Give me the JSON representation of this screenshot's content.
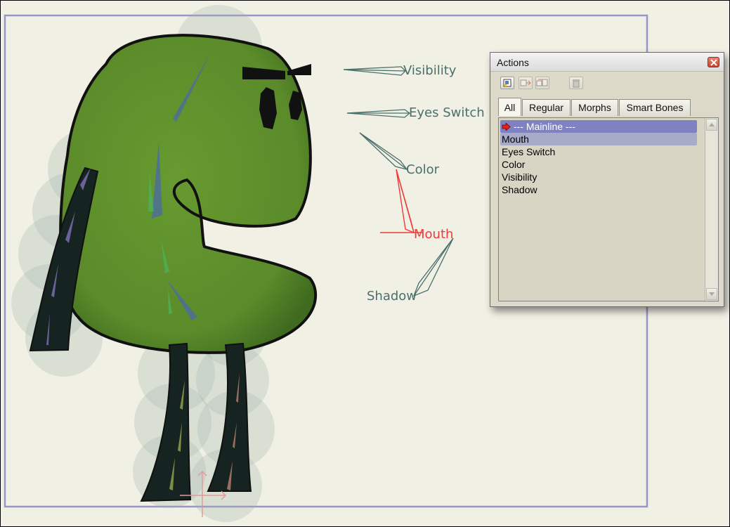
{
  "scene": {
    "bone_labels": [
      {
        "id": "visibility",
        "text": "Visibility"
      },
      {
        "id": "eyes_switch",
        "text": "Eyes Switch"
      },
      {
        "id": "color",
        "text": "Color"
      },
      {
        "id": "mouth",
        "text": "Mouth",
        "active": true
      },
      {
        "id": "shadow",
        "text": "Shadow"
      }
    ],
    "colors": {
      "background": "#f1f0e4",
      "frame": "#9a95c8",
      "body_green": "#5e8f2c",
      "bone_teal": "#4a6f6c",
      "selected_bone": "#f03a3a"
    }
  },
  "actions_window": {
    "title": "Actions",
    "toolbar": [
      "new-action-icon",
      "duplicate-action-icon",
      "copy-action-icon",
      "delete-action-icon"
    ],
    "tabs": [
      "All",
      "Regular",
      "Morphs",
      "Smart Bones"
    ],
    "selected_tab": "All",
    "items": [
      {
        "label": "--- Mainline ---"
      },
      {
        "label": "Mouth"
      },
      {
        "label": "Eyes Switch"
      },
      {
        "label": "Color"
      },
      {
        "label": "Visibility"
      },
      {
        "label": "Shadow"
      }
    ]
  }
}
